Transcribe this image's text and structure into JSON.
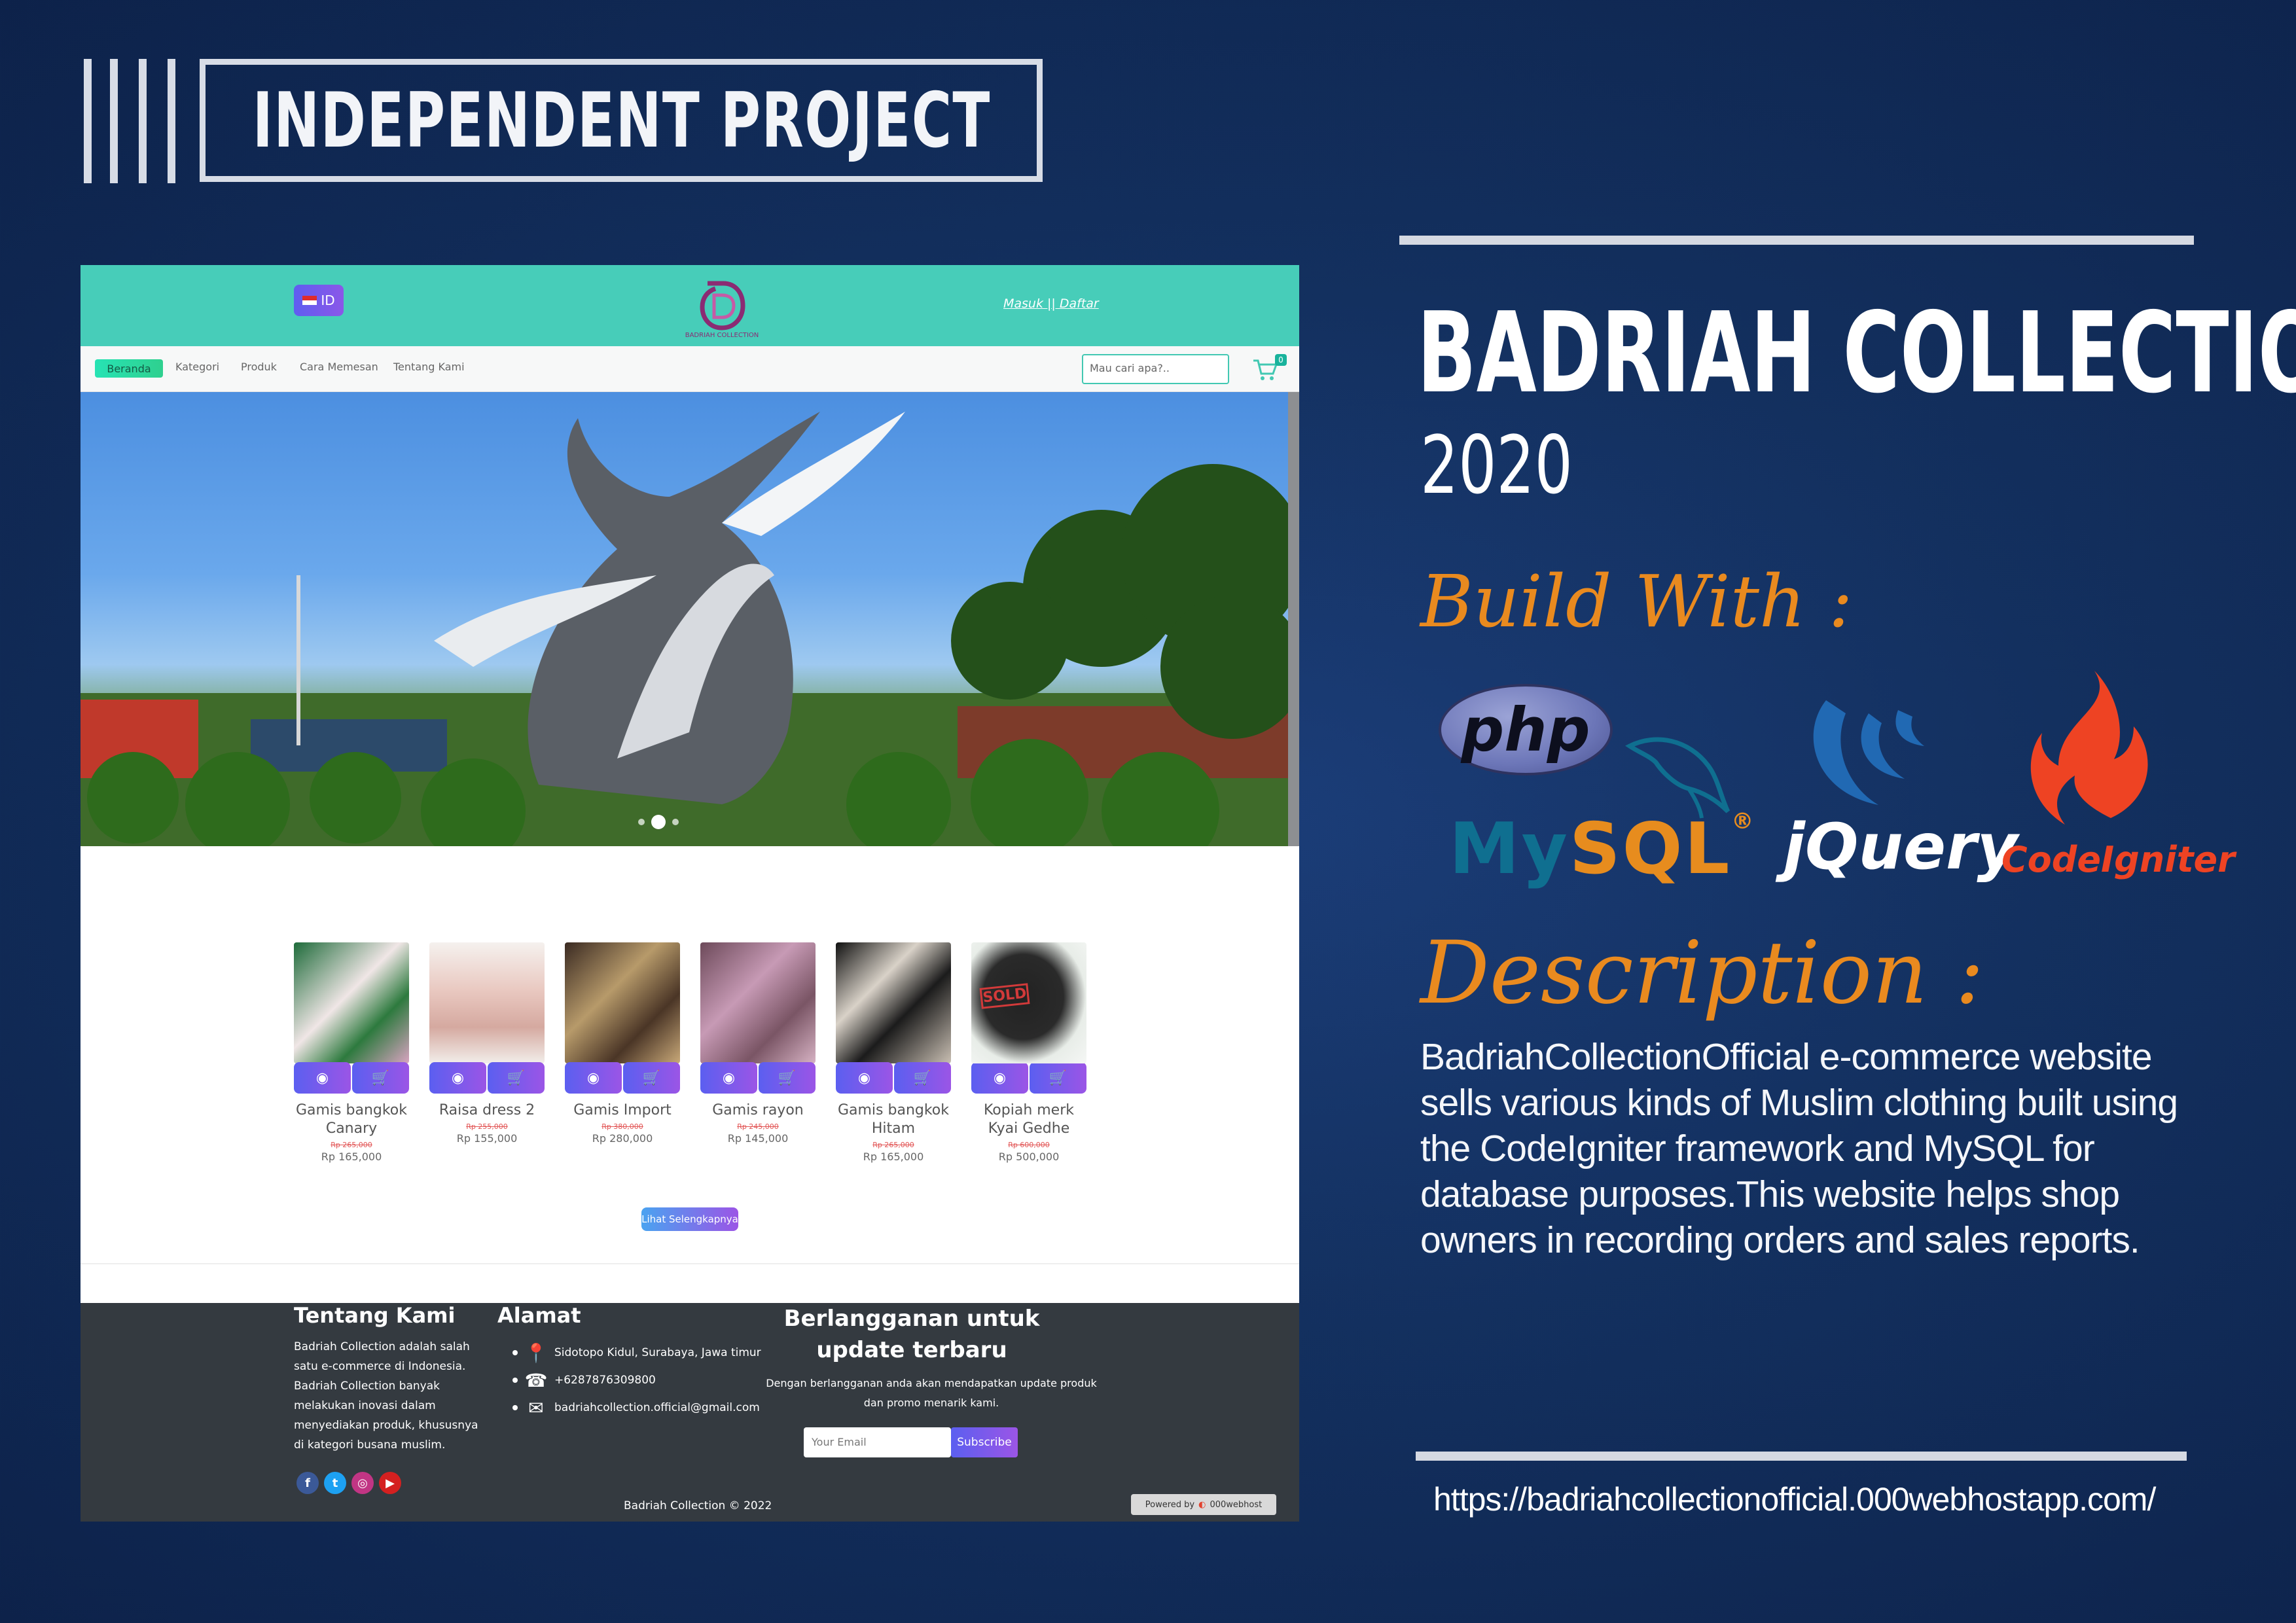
{
  "header": {
    "badge_title": "INDEPENDENT PROJECT"
  },
  "project": {
    "title": "BADRIAH COLLECTION",
    "year": "2020",
    "build_heading": "Build With :",
    "tech": {
      "php": "php",
      "mysql_my": "My",
      "mysql_sql": "SQL",
      "mysql_reg": "®",
      "jquery": "jQuery",
      "codeigniter": "CodeIgniter"
    },
    "description_heading": "Description :",
    "description": "BadriahCollectionOfficial e-commerce website sells various kinds of Muslim clothing built using the CodeIgniter framework and MySQL for database purposes.This website helps shop owners in recording orders and sales reports.",
    "url": "https://badriahcollectionofficial.000webhostapp.com/"
  },
  "site": {
    "lang_label": "ID",
    "logo_text": "BADRIAH COLLECTION",
    "login_link": "Masuk || Daftar",
    "nav": {
      "home": "Beranda",
      "category": "Kategori",
      "product": "Produk",
      "how_to_order": "Cara Memesan",
      "about": "Tentang Kami",
      "search_placeholder": "Mau cari apa?..",
      "cart_count": "0"
    },
    "products": [
      {
        "name": "Gamis bangkok Canary",
        "old_price": "Rp 265,000",
        "price": "Rp 165,000",
        "detail_icon": "eye-icon",
        "cart_icon": "cart-icon"
      },
      {
        "name": "Raisa dress 2",
        "old_price": "Rp 255,000",
        "price": "Rp 155,000",
        "detail_icon": "eye-icon",
        "cart_icon": "cart-icon"
      },
      {
        "name": "Gamis Import",
        "old_price": "Rp 380,000",
        "price": "Rp 280,000",
        "detail_icon": "eye-icon",
        "cart_icon": "cart-icon"
      },
      {
        "name": "Gamis rayon",
        "old_price": "Rp 245,000",
        "price": "Rp 145,000",
        "detail_icon": "eye-icon",
        "cart_icon": "cart-icon"
      },
      {
        "name": "Gamis bangkok Hitam",
        "old_price": "Rp 265,000",
        "price": "Rp 165,000",
        "detail_icon": "eye-icon",
        "cart_icon": "cart-icon"
      },
      {
        "name": "Kopiah merk Kyai Gedhe",
        "old_price": "Rp 600,000",
        "price": "Rp 500,000",
        "detail_icon": "eye-icon",
        "cart_icon": "cart-icon"
      }
    ],
    "more_button": "Lihat Selengkapnya",
    "footer": {
      "about_heading": "Tentang Kami",
      "about_text": "Badriah Collection adalah salah satu e-commerce di Indonesia. Badriah Collection banyak melakukan inovasi dalam menyediakan produk, khususnya di kategori busana muslim.",
      "address_heading": "Alamat",
      "address": "Sidotopo Kidul, Surabaya, Jawa timur",
      "phone": "+6287876309800",
      "email": "badriahcollection.official@gmail.com",
      "subscribe_heading": "Berlangganan untuk update terbaru",
      "subscribe_text": "Dengan berlangganan anda akan mendapatkan update produk dan promo menarik kami.",
      "email_placeholder": "Your Email",
      "subscribe_button": "Subscribe",
      "copyright": "Badriah Collection © 2022",
      "powered_label": "Powered by",
      "powered_brand": "000webhost"
    }
  },
  "colors": {
    "background": "#13305f",
    "accent_orange": "#e98a1f",
    "site_header": "#47cdb9",
    "footer_bg": "#343a40",
    "button_gradient_start": "#5b5ff0",
    "button_gradient_end": "#9b55e6"
  }
}
